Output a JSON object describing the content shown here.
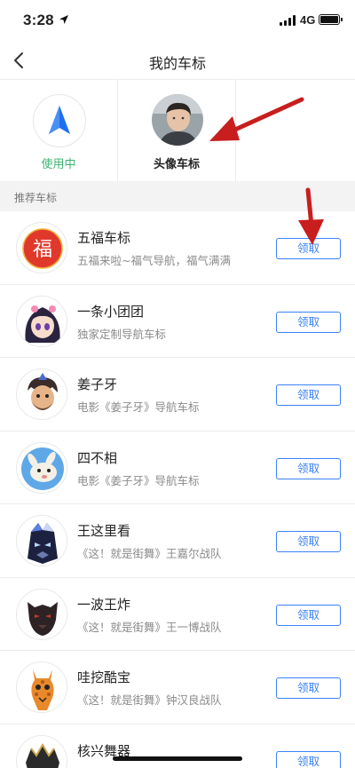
{
  "status_bar": {
    "time": "3:28",
    "network": "4G"
  },
  "nav": {
    "title": "我的车标"
  },
  "tiles": [
    {
      "label": "使用中",
      "icon": "nav-arrow-icon",
      "color": "#3cb371"
    },
    {
      "label": "头像车标",
      "icon": "user-avatar-photo"
    }
  ],
  "section": {
    "title": "推荐车标"
  },
  "items": [
    {
      "title": "五福车标",
      "desc": "五福来啦~福气导航，福气满满",
      "button": "领取",
      "icon": "fu-badge-icon"
    },
    {
      "title": "一条小团团",
      "desc": "独家定制导航车标",
      "button": "领取",
      "icon": "anime-girl-icon"
    },
    {
      "title": "姜子牙",
      "desc": "电影《姜子牙》导航车标",
      "button": "领取",
      "icon": "jiang-ziya-icon"
    },
    {
      "title": "四不相",
      "desc": "电影《姜子牙》导航车标",
      "button": "领取",
      "icon": "sibuxiang-icon"
    },
    {
      "title": "王这里看",
      "desc": "《这！就是街舞》王嘉尔战队",
      "button": "领取",
      "icon": "dark-mask-icon"
    },
    {
      "title": "一波王炸",
      "desc": "《这！就是街舞》王一博战队",
      "button": "领取",
      "icon": "panther-icon"
    },
    {
      "title": "哇挖酷宝",
      "desc": "《这！就是街舞》钟汉良战队",
      "button": "领取",
      "icon": "giraffe-icon"
    },
    {
      "title": "核兴舞器",
      "desc": "",
      "button": "领取",
      "icon": "armor-icon"
    }
  ],
  "colors": {
    "accent_blue": "#3b82f6",
    "active_green": "#3cb371",
    "annotation_red": "#c81e1e"
  }
}
